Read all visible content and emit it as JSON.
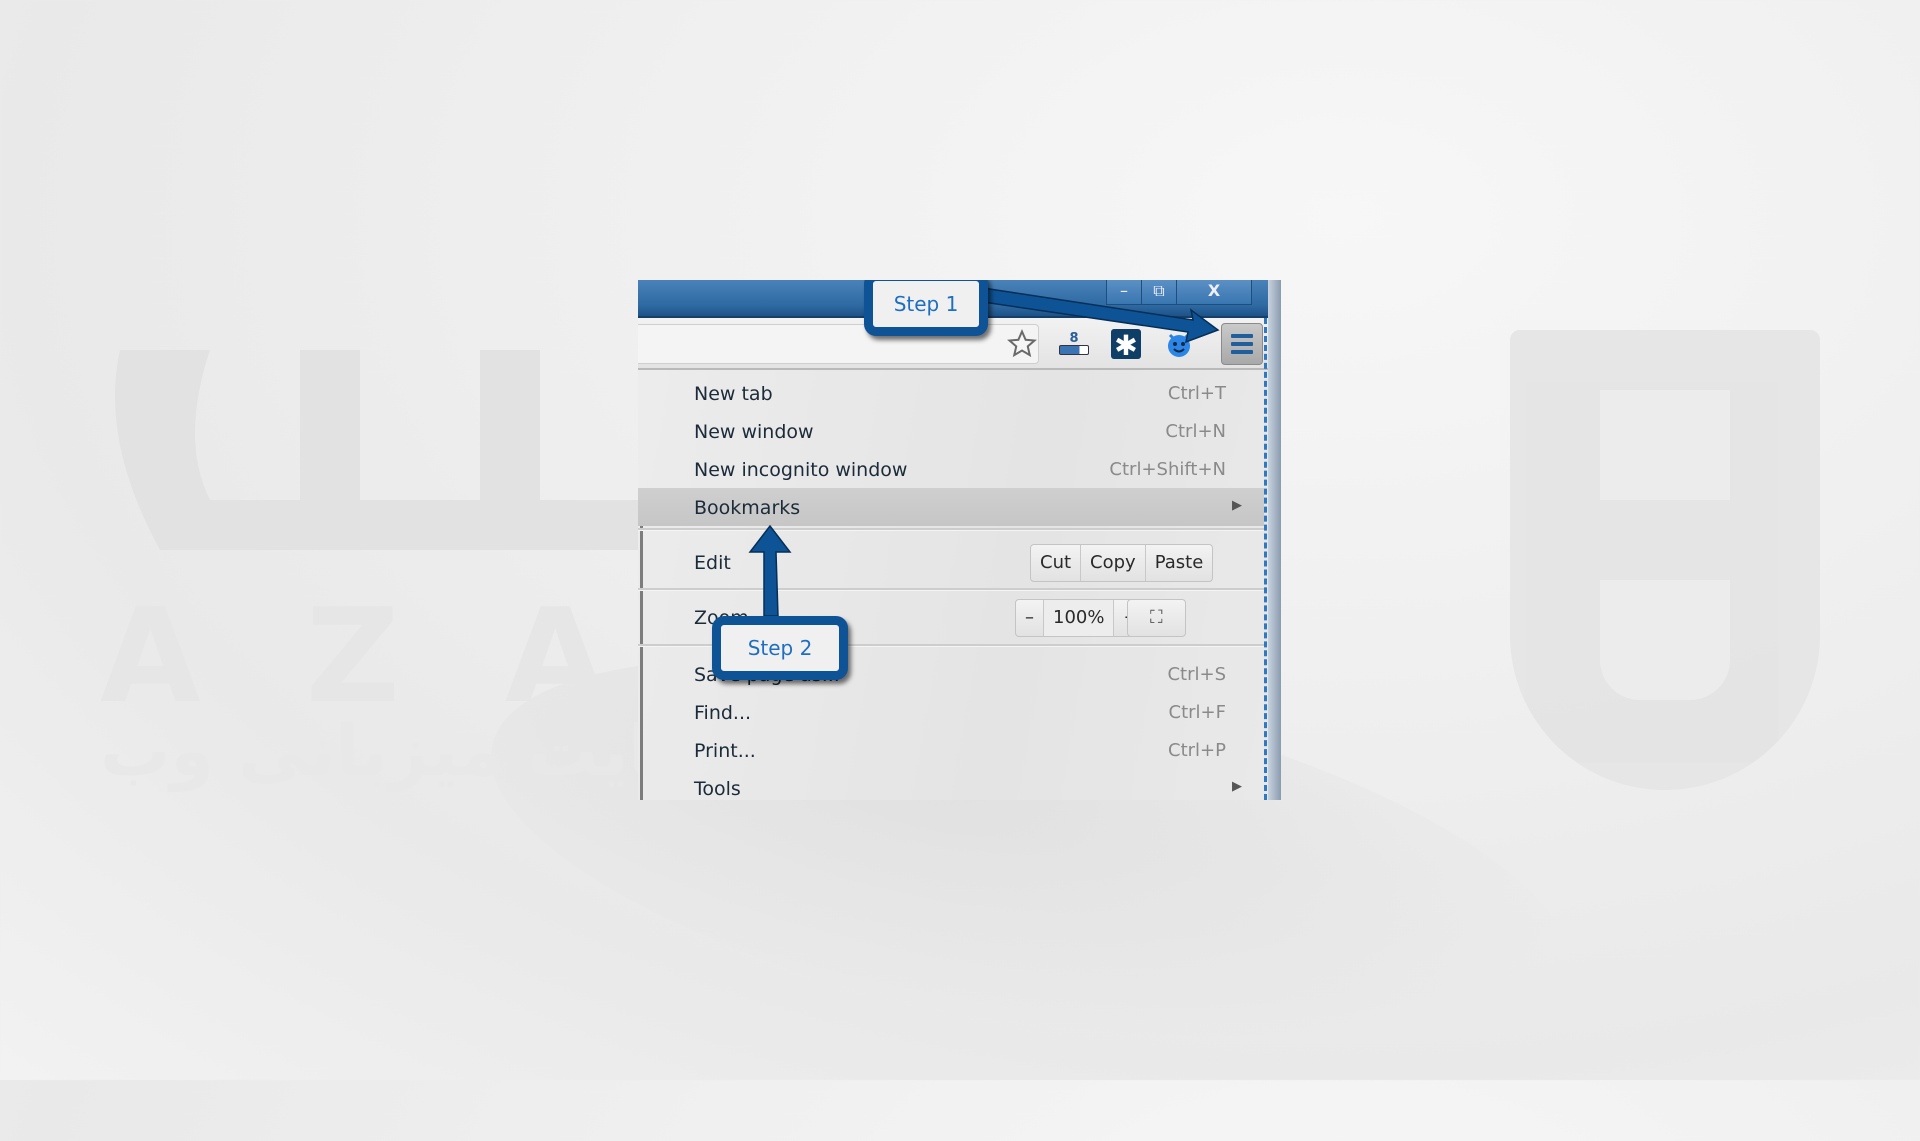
{
  "watermark": {
    "letters": "AZASYS",
    "tagline": "سرعت بی نهایت میزبانی وب"
  },
  "window_controls": {
    "minimize": "–",
    "restore": "⧉",
    "close": "X"
  },
  "toolbar": {
    "icons": [
      "bookmark-star-icon",
      "extension-badge-icon",
      "extension-asterisk-icon",
      "extension-face-icon",
      "chrome-menu-icon"
    ],
    "badge_count": "8"
  },
  "menu": {
    "items": [
      {
        "label": "New tab",
        "shortcut": "Ctrl+T"
      },
      {
        "label": "New window",
        "shortcut": "Ctrl+N"
      },
      {
        "label": "New incognito window",
        "shortcut": "Ctrl+Shift+N"
      },
      {
        "label": "Bookmarks",
        "submenu": "▶"
      },
      {
        "label": "Edit"
      },
      {
        "label": "Zoom"
      },
      {
        "label": "Save page as...",
        "shortcut": "Ctrl+S"
      },
      {
        "label": "Find...",
        "shortcut": "Ctrl+F"
      },
      {
        "label": "Print...",
        "shortcut": "Ctrl+P"
      },
      {
        "label": "Tools",
        "submenu": "▶"
      }
    ],
    "edit_buttons": {
      "cut": "Cut",
      "copy": "Copy",
      "paste": "Paste"
    },
    "zoom_controls": {
      "minus": "–",
      "level": "100%",
      "plus": "+",
      "fullscreen": "⛶"
    }
  },
  "callouts": {
    "step1": "Step 1",
    "step2": "Step 2"
  },
  "colors": {
    "callout_border": "#0e5396",
    "titlebar": "#2f6aa3",
    "callout_text": "#1f6fc0"
  }
}
